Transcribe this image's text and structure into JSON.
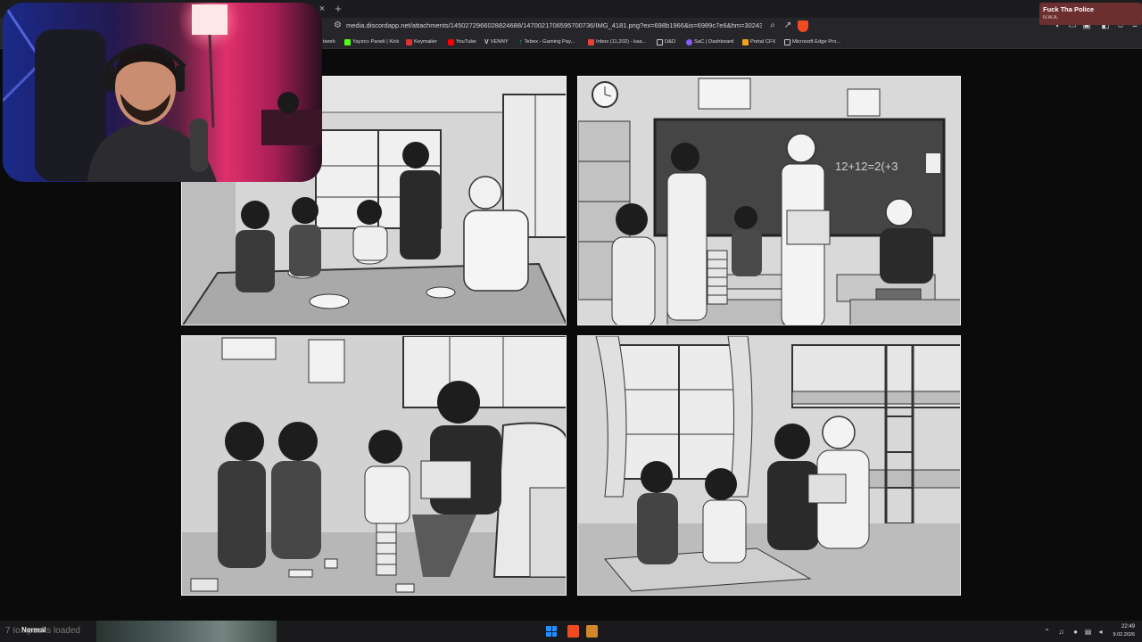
{
  "browser": {
    "url": "media.discordapp.net/attachments/1450272966028824688/1470021706595700736/IMG_4181.png?ex=698b1966&is=6989c7e6&hm=302433f64d57...",
    "tab_close_glyph": "×",
    "tab_new_glyph": "+",
    "bookmarks": [
      {
        "label": "twork",
        "icon": "none"
      },
      {
        "label": "Yayıncı Paneli | Kick",
        "icon": "kick-icon",
        "color": "#53fc18"
      },
      {
        "label": "Keymailer",
        "icon": "keymailer-icon",
        "color": "#e33"
      },
      {
        "label": "YouTube",
        "icon": "youtube-icon",
        "color": "#ff0000"
      },
      {
        "label": "VENNY",
        "icon": "venny-icon",
        "color": "#ffffff"
      },
      {
        "label": "Tebex - Gaming Pay...",
        "icon": "tebex-icon",
        "color": "#2ecc71"
      },
      {
        "label": "Inbox (11,202) - kaa...",
        "icon": "gmail-icon",
        "color": "#ea4335"
      },
      {
        "label": "D&D",
        "icon": "folder-icon",
        "color": "#cccccc"
      },
      {
        "label": "SaC | Dashboard",
        "icon": "sac-icon",
        "color": "#8a5cf6"
      },
      {
        "label": "Portal CFX",
        "icon": "cfx-icon",
        "color": "#f0a020"
      },
      {
        "label": "Microsoft Edge Pro...",
        "icon": "folder-icon",
        "color": "#cccccc"
      }
    ]
  },
  "now_playing": {
    "title": "Fuck Tha Police",
    "artist": "N.W.A."
  },
  "panels": [
    {
      "name": "dining-table-scene",
      "chalk": ""
    },
    {
      "name": "classroom-scene",
      "chalk": "12+12=2(+3"
    },
    {
      "name": "living-room-jenga-scene",
      "chalk": ""
    },
    {
      "name": "bunkbed-room-scene",
      "chalk": ""
    }
  ],
  "taskbar": {
    "status_text": "7 Io...packs loaded",
    "mode_label": "Normal",
    "time": "22:49",
    "date": "9.02.2026"
  }
}
